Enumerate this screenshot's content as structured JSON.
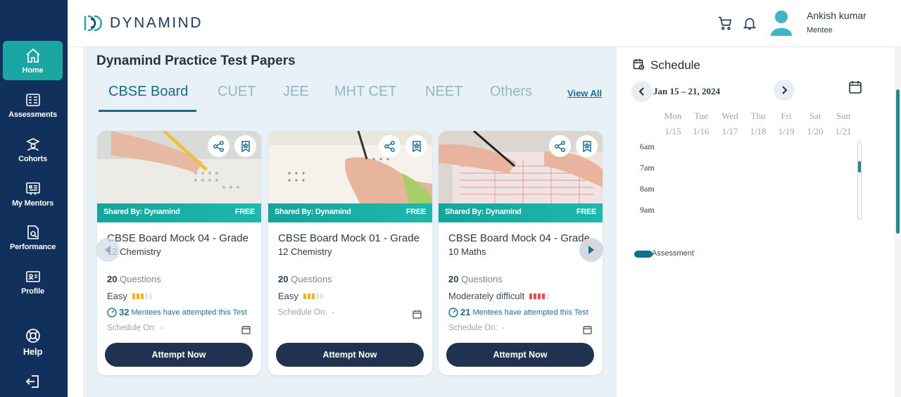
{
  "sidebar": {
    "items": [
      {
        "label": "Home",
        "icon": "home-icon"
      },
      {
        "label": "Assessments",
        "icon": "assessments-icon"
      },
      {
        "label": "Cohorts",
        "icon": "cohorts-icon"
      },
      {
        "label": "My Mentors",
        "icon": "mentors-icon"
      },
      {
        "label": "Performance",
        "icon": "performance-icon"
      },
      {
        "label": "Profile",
        "icon": "profile-icon"
      },
      {
        "label": "Help",
        "icon": "help-icon"
      }
    ],
    "logout_icon": "logout-icon"
  },
  "header": {
    "brand": "DYNAMIND",
    "user_name": "Ankish kumar",
    "user_role": "Mentee"
  },
  "main": {
    "title": "Dynamind Practice Test Papers",
    "tabs": [
      "CBSE Board",
      "CUET",
      "JEE",
      "MHT CET",
      "NEET",
      "Others"
    ],
    "active_tab": "CBSE Board",
    "view_all": "View All",
    "cards": [
      {
        "shared_by": "Shared By: Dynamind",
        "price": "FREE",
        "title_line1": "CBSE Board Mock 04 - Grade",
        "title_line2": "12 Chemistry",
        "questions_count": "20",
        "questions_label": "Questions",
        "difficulty": "Easy",
        "difficulty_level": 3,
        "attempted_count": "32",
        "attempted_text": "Mentees have attempted this Test",
        "schedule_label": "Schedule On:",
        "schedule_value": "-",
        "cta": "Attempt Now"
      },
      {
        "shared_by": "Shared By: Dynamind",
        "price": "FREE",
        "title_line1": "CBSE Board Mock 01 - Grade",
        "title_line2": "12 Chemistry",
        "questions_count": "20",
        "questions_label": "Questions",
        "difficulty": "Easy",
        "difficulty_level": 3,
        "schedule_label": "Schedule On:",
        "schedule_value": "-",
        "cta": "Attempt Now"
      },
      {
        "shared_by": "Shared By: Dynamind",
        "price": "FREE",
        "title_line1": "CBSE Board Mock 04 - Grade",
        "title_line2": "10 Maths",
        "questions_count": "20",
        "questions_label": "Questions",
        "difficulty": "Moderately difficult",
        "difficulty_level": 4,
        "attempted_count": "21",
        "attempted_text": "Mentees have attempted this Test",
        "schedule_label": "Schedule On:",
        "schedule_value": "-",
        "cta": "Attempt Now"
      }
    ]
  },
  "schedule": {
    "title": "Schedule",
    "week_range": "Jan 15 – 21, 2024",
    "days": [
      {
        "name": "Mon",
        "date": "1/15"
      },
      {
        "name": "Tue",
        "date": "1/16"
      },
      {
        "name": "Wed",
        "date": "1/17"
      },
      {
        "name": "Thu",
        "date": "1/18"
      },
      {
        "name": "Fri",
        "date": "1/19"
      },
      {
        "name": "Sat",
        "date": "1/20"
      },
      {
        "name": "Sun",
        "date": "1/21"
      }
    ],
    "times": [
      "6am",
      "7am",
      "8am",
      "9am"
    ],
    "legend": "Assessment"
  },
  "colors": {
    "sidebar_bg": "#12305c",
    "accent_teal": "#1aa6a1",
    "tab_active": "#1a6a8a",
    "button_dark": "#1f3350",
    "easy_bar": "#f2b51e",
    "moderate_bar": "#ea4f4f",
    "legend_assessment": "#0f6f93"
  }
}
